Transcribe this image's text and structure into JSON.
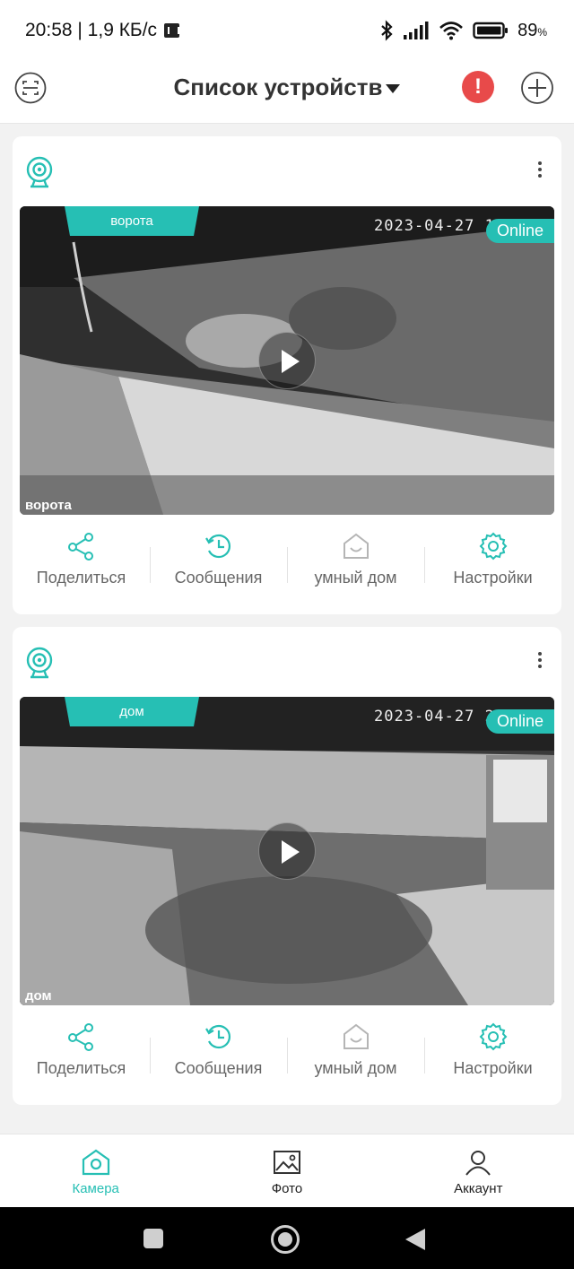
{
  "status_bar": {
    "time_speed": "20:58 | 1,9 КБ/с",
    "battery": "89",
    "battery_unit": "%"
  },
  "header": {
    "title": "Список устройств",
    "alert_glyph": "!"
  },
  "devices": [
    {
      "name_tab": "ворота",
      "timestamp": "2023-04-27  12",
      "status": "Online",
      "osd_name": "ворота"
    },
    {
      "name_tab": "дом",
      "timestamp": "2023-04-27  20",
      "status": "Online",
      "osd_name": "дом"
    }
  ],
  "actions": {
    "share": "Поделиться",
    "messages": "Сообщения",
    "smart_home": "умный дом",
    "settings": "Настройки"
  },
  "bottom_nav": {
    "camera": "Камера",
    "photo": "Фото",
    "account": "Аккаунт"
  },
  "colors": {
    "accent": "#26bfb4",
    "alert": "#e84a4a"
  },
  "icons": [
    "scan-icon",
    "alert-icon",
    "add-icon",
    "camera-device-icon",
    "more-icon",
    "play-icon",
    "share-icon",
    "messages-icon",
    "smart-home-icon",
    "settings-icon",
    "camera-nav-icon",
    "photo-nav-icon",
    "account-nav-icon"
  ]
}
